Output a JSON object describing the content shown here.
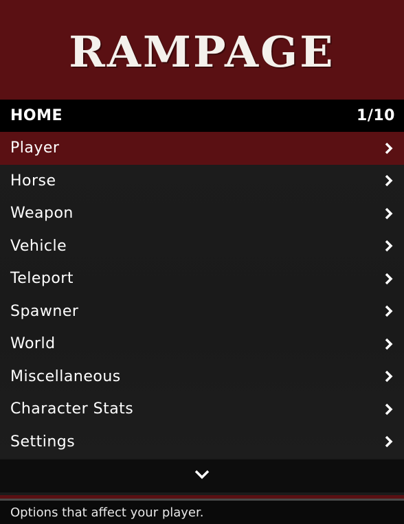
{
  "header": {
    "title": "RAMPAGE"
  },
  "subheader": {
    "section": "HOME",
    "counter": "1/10"
  },
  "menu": {
    "items": [
      {
        "label": "Player"
      },
      {
        "label": "Horse"
      },
      {
        "label": "Weapon"
      },
      {
        "label": "Vehicle"
      },
      {
        "label": "Teleport"
      },
      {
        "label": "Spawner"
      },
      {
        "label": "World"
      },
      {
        "label": "Miscellaneous"
      },
      {
        "label": "Character Stats"
      },
      {
        "label": "Settings"
      }
    ],
    "selected_index": 0
  },
  "icons": {
    "item_arrow": "chevron-right-icon",
    "scroll": "chevron-down-icon"
  },
  "colors": {
    "accent": "#5a1013",
    "background": "#1b1b1b",
    "text": "#ffffff"
  },
  "footer": {
    "description": "Options that affect your player."
  }
}
